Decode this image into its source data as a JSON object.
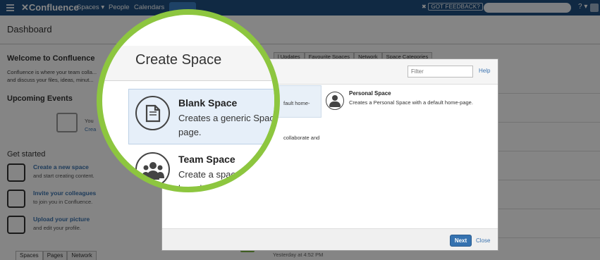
{
  "topbar": {
    "logo": "Confluence",
    "nav": [
      "Spaces ▾",
      "People",
      "Calendars"
    ],
    "feedback": "GOT FEEDBACK?",
    "help": "? ▾"
  },
  "page": {
    "title": "Dashboard",
    "welcome_title": "Welcome to Confluence",
    "welcome_text": "Confluence is where your team colla... and discuss your files, ideas, minut...",
    "upcoming_title": "Upcoming Events",
    "upcoming_you": "You",
    "upcoming_create": "Crea",
    "get_started_title": "Get started",
    "get_started": [
      {
        "title": "Create a new space",
        "subtitle": "and start creating content."
      },
      {
        "title": "Invite your colleagues",
        "subtitle": "to join you in Confluence."
      },
      {
        "title": "Upload your picture",
        "subtitle": "and edit your profile."
      }
    ],
    "bottom_tabs": [
      "Spaces",
      "Pages",
      "Network"
    ],
    "bg_tabs": [
      "l Updates",
      "Favourite Spaces",
      "Network",
      "Space Categories"
    ],
    "yesterday": "Yesterday at 4:52 PM"
  },
  "dialog": {
    "title": "Create Space",
    "filter_placeholder": "Filter",
    "help": "Help",
    "blank_space": {
      "title": "Blank Space",
      "description": "Creates a generic Space with a default home-page.",
      "fragment": "fault home-"
    },
    "team_space": {
      "title": "Team Space",
      "description": "Create a space for your team to collaborate and share knowledge.",
      "fragment": "collaborate and"
    },
    "personal_space": {
      "title": "Personal Space",
      "description": "Creates a Personal Space with a default home-page."
    },
    "next": "Next",
    "close": "Close"
  },
  "magnifier": {
    "title": "Create Space",
    "blank_title": "Blank Space",
    "blank_desc": "Creates a generic Space page.",
    "team_title": "Team Space",
    "team_desc": "Create a space for share knowledge"
  },
  "colors": {
    "topbar": "#205081",
    "accent_green": "#8dc63f",
    "link": "#3b73af",
    "primary_button": "#3572b0"
  }
}
